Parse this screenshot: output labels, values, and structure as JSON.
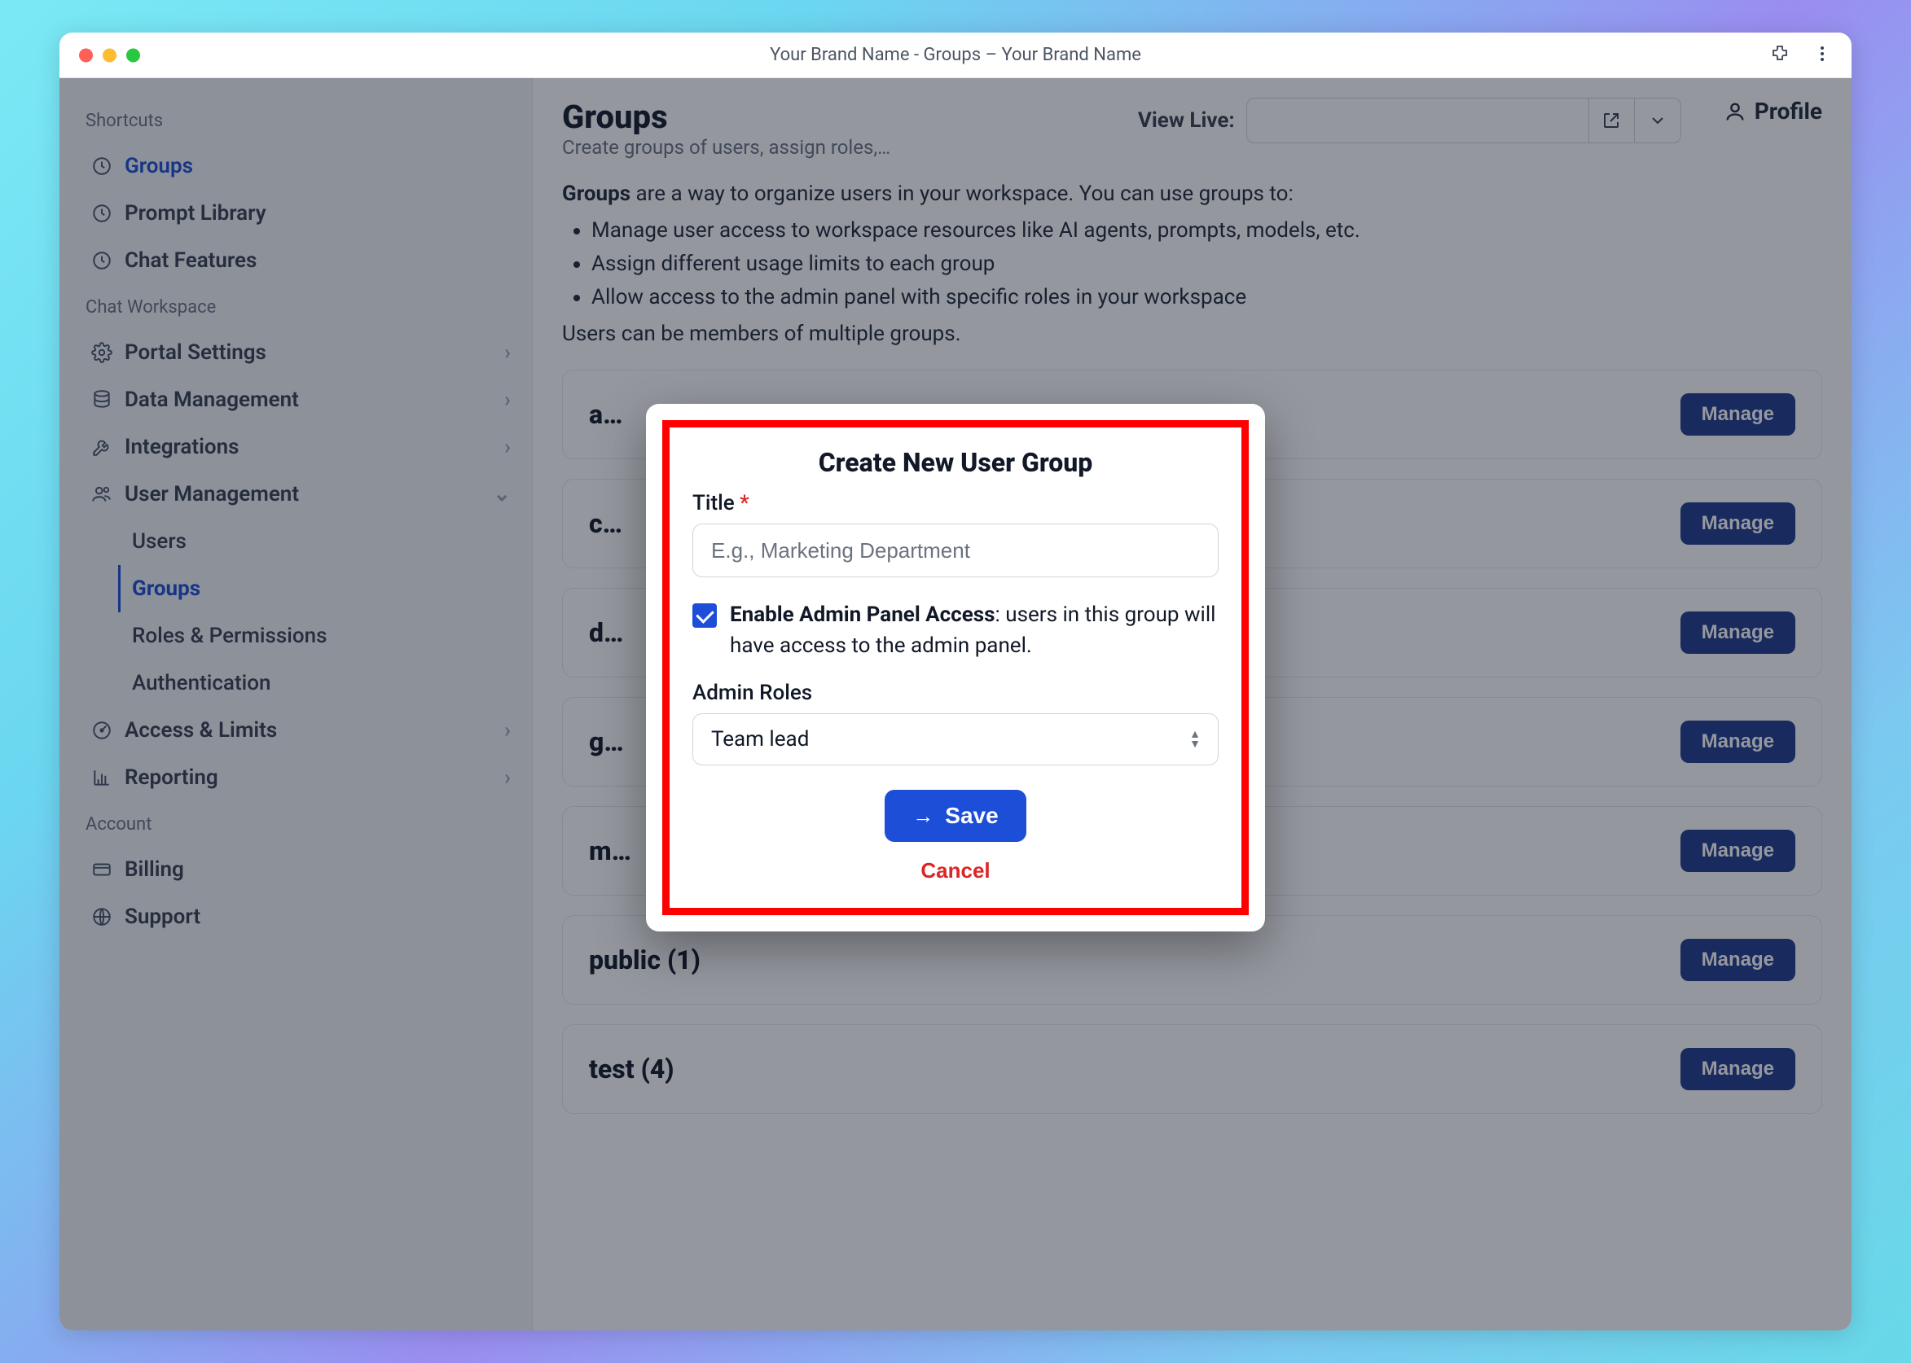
{
  "window": {
    "title": "Your Brand Name - Groups – Your Brand Name"
  },
  "sidebar": {
    "sections": {
      "shortcuts": {
        "label": "Shortcuts",
        "items": [
          "Groups",
          "Prompt Library",
          "Chat Features"
        ]
      },
      "workspace": {
        "label": "Chat Workspace",
        "items": [
          {
            "label": "Portal Settings"
          },
          {
            "label": "Data Management"
          },
          {
            "label": "Integrations"
          },
          {
            "label": "User Management",
            "expanded": true,
            "children": [
              {
                "label": "Users"
              },
              {
                "label": "Groups",
                "active": true
              },
              {
                "label": "Roles & Permissions"
              },
              {
                "label": "Authentication"
              }
            ]
          },
          {
            "label": "Access & Limits"
          },
          {
            "label": "Reporting"
          }
        ]
      },
      "account": {
        "label": "Account",
        "items": [
          "Billing",
          "Support"
        ]
      }
    }
  },
  "main": {
    "title": "Groups",
    "subtitle": "Create groups of users, assign roles,…",
    "viewlive_label": "View Live:",
    "profile_label": "Profile",
    "intro_lead": "Groups",
    "intro_rest": " are a way to organize users in your workspace. You can use groups to:",
    "intro_bullets": [
      "Manage user access to workspace resources like AI agents, prompts, models, etc.",
      "Assign different usage limits to each group",
      "Allow access to the admin panel with specific roles in your workspace"
    ],
    "intro_footer": "Users can be members of multiple groups.",
    "groups": [
      {
        "name": "a…"
      },
      {
        "name": "c…"
      },
      {
        "name": "d…"
      },
      {
        "name": "g…"
      },
      {
        "name": "m…"
      },
      {
        "name": "public (1)"
      },
      {
        "name": "test (4)"
      }
    ],
    "manage_label": "Manage"
  },
  "modal": {
    "title": "Create New User Group",
    "title_field_label": "Title",
    "title_placeholder": "E.g., Marketing Department",
    "title_value": "",
    "admin_checkbox_bold": "Enable Admin Panel Access",
    "admin_checkbox_rest": ": users in this group will have access to the admin panel.",
    "admin_roles_label": "Admin Roles",
    "admin_roles_value": "Team lead",
    "save_label": "Save",
    "cancel_label": "Cancel"
  }
}
